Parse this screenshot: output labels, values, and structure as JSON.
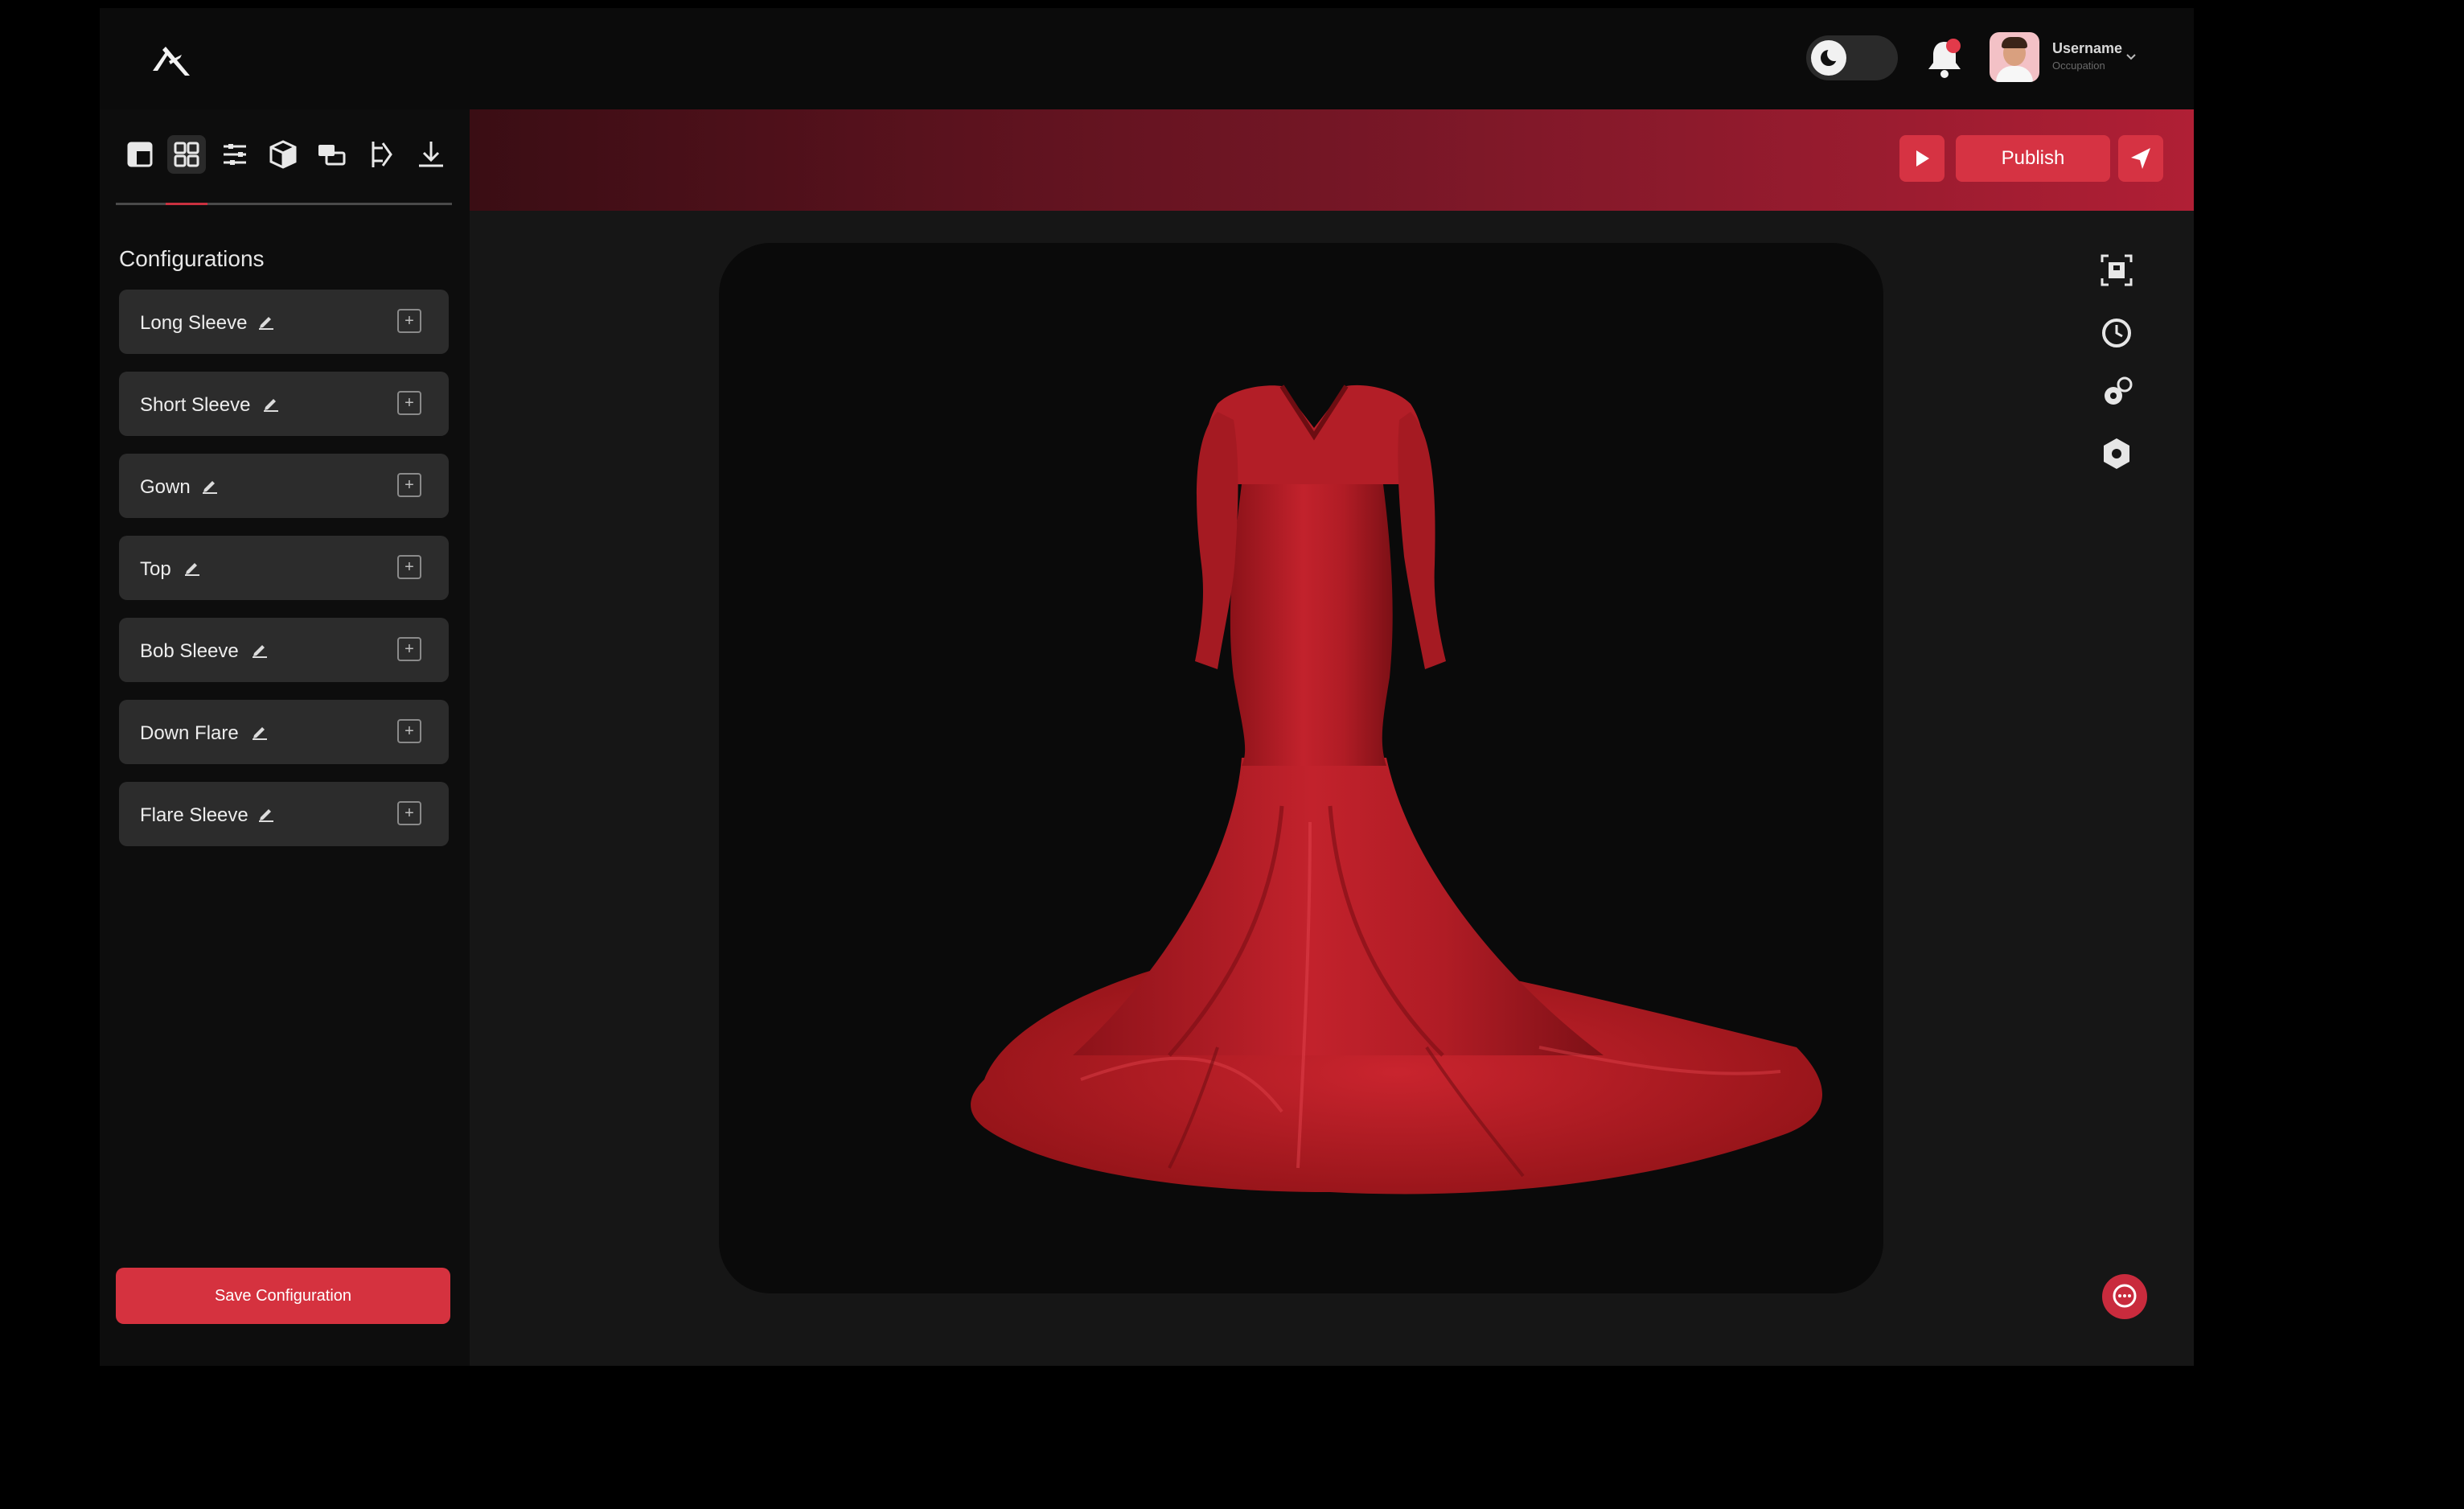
{
  "user": {
    "name": "Username",
    "occupation": "Occupation"
  },
  "sidebar": {
    "title": "Configurations",
    "tools": [
      "layout-icon",
      "grid-icon",
      "sliders-icon",
      "cube-icon",
      "layers-icon",
      "flow-icon",
      "download-icon"
    ],
    "active_tool": "grid-icon",
    "items": [
      {
        "label": "Long Sleeve"
      },
      {
        "label": "Short Sleeve"
      },
      {
        "label": "Gown"
      },
      {
        "label": "Top"
      },
      {
        "label": "Bob Sleeve"
      },
      {
        "label": "Down Flare"
      },
      {
        "label": "Flare Sleeve"
      }
    ],
    "save_label": "Save Configuration"
  },
  "header": {
    "publish_label": "Publish"
  },
  "right_tools": [
    "frame-icon",
    "history-icon",
    "settings-gears-icon",
    "hexagon-icon"
  ],
  "colors": {
    "accent": "#d5323f",
    "garment": "#b51d26",
    "background": "#161616"
  }
}
